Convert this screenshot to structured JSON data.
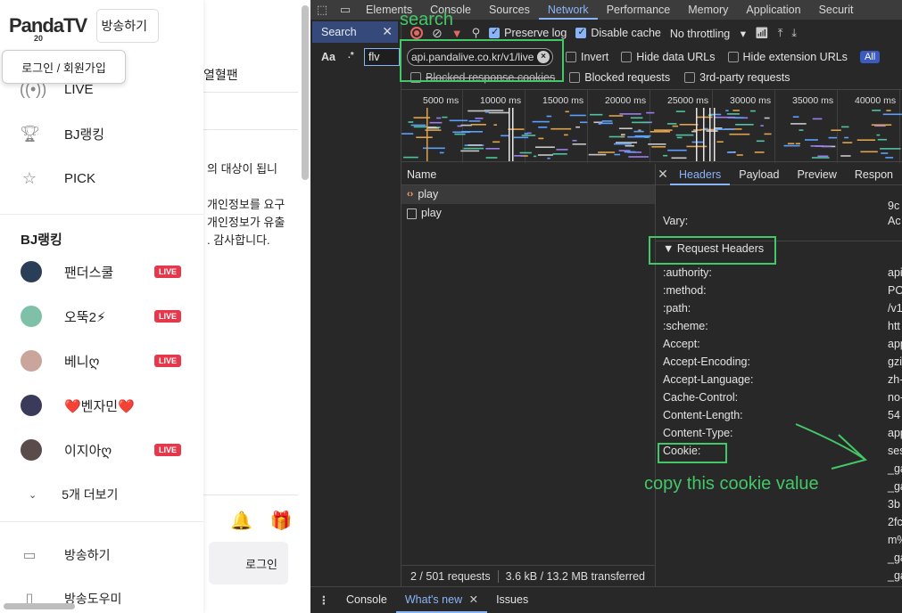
{
  "site": {
    "logo_text": "PandaTV",
    "logo_year": "20",
    "broadcast_top_button": "방송하기",
    "login_popup": "로그인 / 회원가입",
    "nav": [
      {
        "icon": "live-icon",
        "label": "LIVE"
      },
      {
        "icon": "trophy-icon",
        "label": "BJ랭킹"
      },
      {
        "icon": "star-icon",
        "label": "PICK"
      }
    ],
    "bj_heading": "BJ랭킹",
    "bj_list": [
      {
        "name": "팬더스쿨",
        "live": true,
        "color": "#2b3e57"
      },
      {
        "name": "오뚝2⚡",
        "live": true,
        "color": "#7fc1a8"
      },
      {
        "name": "베니ღ",
        "live": true,
        "color": "#c9a59b"
      },
      {
        "name": "❤️벤자민❤️",
        "live": false,
        "color": "#3a3a5a"
      },
      {
        "name": "이지아ღ",
        "live": true,
        "color": "#5b4c4c"
      }
    ],
    "live_badge": "LIVE",
    "more_label": "5개 더보기",
    "bottom_nav": [
      {
        "icon": "video-camera-icon",
        "label": "방송하기"
      },
      {
        "icon": "document-icon",
        "label": "방송도우미"
      }
    ],
    "background": {
      "tab_label": "열혈팬",
      "text_lines": [
        "의 대상이 됩니",
        "개인정보를 요구",
        "개인정보가 유출",
        ". 감사합니다."
      ],
      "login_button": "로그인"
    }
  },
  "devtools": {
    "tabs": [
      "Elements",
      "Console",
      "Sources",
      "Network",
      "Performance",
      "Memory",
      "Application",
      "Securit"
    ],
    "active_tab": "Network",
    "search_panel_title": "Search",
    "search_options": {
      "case": "Aa",
      "regex": ".*"
    },
    "search_query": "flv",
    "toolbar": {
      "preserve_log": "Preserve log",
      "disable_cache": "Disable cache",
      "throttling": "No throttling"
    },
    "filter": {
      "value": "api.pandalive.co.kr/v1/live",
      "invert": "Invert",
      "hide_data_urls": "Hide data URLs",
      "hide_extension_urls": "Hide extension URLs",
      "all": "All",
      "blocked_response_cookies": "Blocked response cookies",
      "blocked_requests": "Blocked requests",
      "third_party": "3rd-party requests"
    },
    "timeline_ticks": [
      "5000 ms",
      "10000 ms",
      "15000 ms",
      "20000 ms",
      "25000 ms",
      "30000 ms",
      "35000 ms",
      "40000 ms"
    ],
    "name_column": "Name",
    "requests": [
      {
        "name": "play",
        "type": "xhr",
        "selected": true
      },
      {
        "name": "play",
        "type": "doc",
        "selected": false
      }
    ],
    "status": {
      "requests": "2 / 501 requests",
      "transferred": "3.6 kB / 13.2 MB transferred"
    },
    "detail_tabs": [
      "Headers",
      "Payload",
      "Preview",
      "Respon"
    ],
    "active_detail_tab": "Headers",
    "response_headers_partial": [
      {
        "name": "",
        "value": "9c"
      },
      {
        "name": "Vary:",
        "value": "Ac"
      }
    ],
    "request_headers_title": "▼ Request Headers",
    "request_headers": [
      {
        "name": ":authority:",
        "value": "api"
      },
      {
        "name": ":method:",
        "value": "PO"
      },
      {
        "name": ":path:",
        "value": "/v1"
      },
      {
        "name": ":scheme:",
        "value": "htt"
      },
      {
        "name": "Accept:",
        "value": "app"
      },
      {
        "name": "Accept-Encoding:",
        "value": "gzi"
      },
      {
        "name": "Accept-Language:",
        "value": "zh-"
      },
      {
        "name": "Cache-Control:",
        "value": "no-"
      },
      {
        "name": "Content-Length:",
        "value": "54"
      },
      {
        "name": "Content-Type:",
        "value": "app"
      },
      {
        "name": "Cookie:",
        "value": "ses"
      }
    ],
    "cookie_continuation": [
      "_ga",
      "_ga",
      "3b",
      "2fc",
      "m%",
      "_ga",
      "_ga"
    ],
    "drawer_tabs": [
      "Console",
      "What's new",
      "Issues"
    ],
    "active_drawer_tab": "What's new"
  },
  "annotations": {
    "search_label": "search",
    "copy_label": "copy this cookie value",
    "color": "#44c767"
  }
}
